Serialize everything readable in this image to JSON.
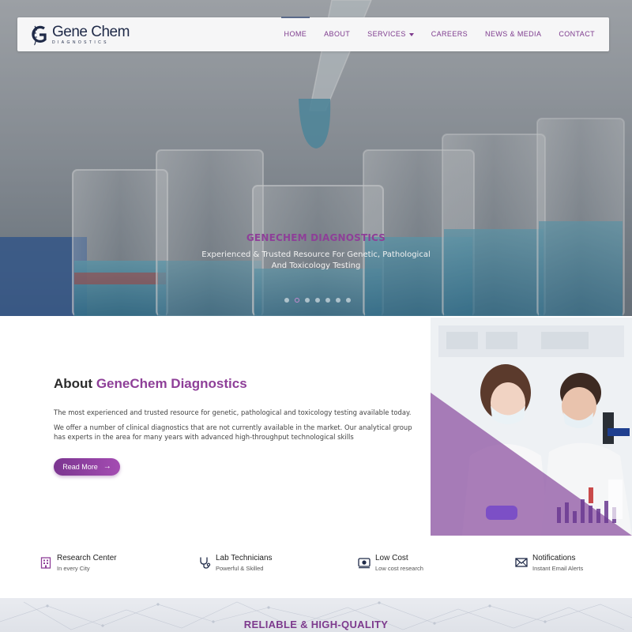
{
  "brand": {
    "name": "Gene Chem",
    "tagline": "DIAGNOSTICS"
  },
  "nav": {
    "items": [
      {
        "label": "HOME",
        "active": true
      },
      {
        "label": "ABOUT"
      },
      {
        "label": "SERVICES",
        "has_dropdown": true
      },
      {
        "label": "CAREERS"
      },
      {
        "label": "NEWS & MEDIA"
      },
      {
        "label": "CONTACT"
      }
    ]
  },
  "hero": {
    "title": "GENECHEM DIAGNOSTICS",
    "subtitle": "Experienced & Trusted Resource For Genetic, Pathological And Toxicology Testing",
    "slide_count": 7,
    "active_slide": 2
  },
  "about": {
    "title_prefix": "About ",
    "title_highlight": "GeneChem Diagnostics",
    "paragraph1": "The most experienced and trusted resource for genetic, pathological and toxicology testing available today.",
    "paragraph2": "We offer a number of clinical diagnostics that are not currently available in the market. Our analytical group has experts in the area for many years with advanced high-throughput technological skills",
    "button_label": "Read More"
  },
  "features": [
    {
      "title": "Research Center",
      "subtitle": "In every City",
      "icon": "building-icon"
    },
    {
      "title": "Lab Technicians",
      "subtitle": "Powerful & Skilled",
      "icon": "stethoscope-icon"
    },
    {
      "title": "Low Cost",
      "subtitle": "Low cost research",
      "icon": "money-icon"
    },
    {
      "title": "Notifications",
      "subtitle": "Instant Email Alerts",
      "icon": "envelope-icon"
    }
  ],
  "band": {
    "title": "RELIABLE & HIGH-QUALITY"
  },
  "colors": {
    "accent": "#8e3f98",
    "nav_text": "#7d3a8d",
    "logo_navy": "#1f2a48"
  }
}
